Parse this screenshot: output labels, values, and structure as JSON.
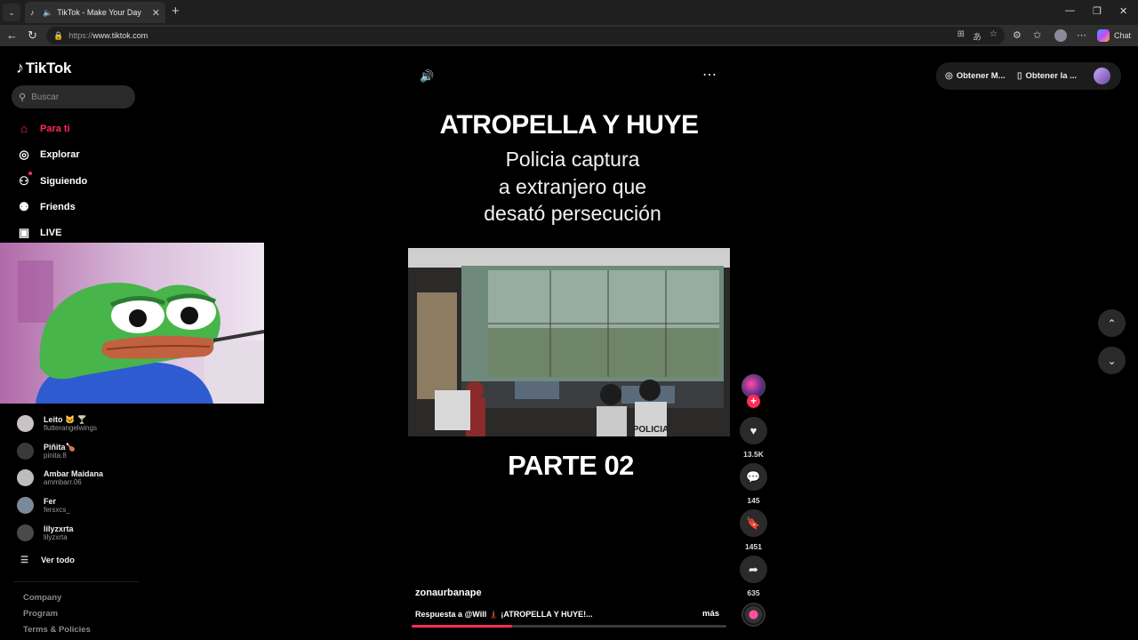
{
  "browser": {
    "tab_title": "TikTok - Make Your Day",
    "url_proto": "https://",
    "url_host": "www.tiktok.com",
    "chat_label": "Chat"
  },
  "sidebar": {
    "brand": "TikTok",
    "search_placeholder": "Buscar",
    "nav": [
      {
        "label": "Para ti",
        "icon": "home-icon",
        "active": true
      },
      {
        "label": "Explorar",
        "icon": "compass-icon"
      },
      {
        "label": "Siguiendo",
        "icon": "following-icon"
      },
      {
        "label": "Friends",
        "icon": "friends-icon"
      },
      {
        "label": "LIVE",
        "icon": "live-icon"
      }
    ],
    "following_accounts": [
      {
        "name": "Leito 🐱 🍸",
        "handle": "flutterangelwings"
      },
      {
        "name": "Piñita🍗",
        "handle": "pinita.8"
      },
      {
        "name": "Ambar Maidana",
        "handle": "ammbarr.06"
      },
      {
        "name": "Fer",
        "handle": "fersxcs_"
      },
      {
        "name": "lilyzxrta",
        "handle": "lilyzxrta"
      }
    ],
    "see_all": "Ver todo",
    "footer": [
      "Company",
      "Program",
      "Terms & Policies"
    ]
  },
  "video": {
    "headline": "ATROPELLA Y HUYE",
    "subtitle_lines": [
      "Policia captura",
      "a extranjero que",
      "desató persecución"
    ],
    "part_label": "PARTE 02",
    "author": "zonaurbanape",
    "caption": "Respuesta a @Will 🗼 ¡ATROPELLA Y HUYE!...",
    "more": "más",
    "progress": 0.32,
    "frame_sign": "POLICIA"
  },
  "actions": {
    "likes": "13.5K",
    "comments": "145",
    "saves": "1451",
    "shares": "635"
  },
  "top_right": {
    "get_coins": "Obtener M...",
    "get_app": "Obtener la ..."
  },
  "colors": {
    "accent": "#fe2c55",
    "background": "#000000"
  }
}
